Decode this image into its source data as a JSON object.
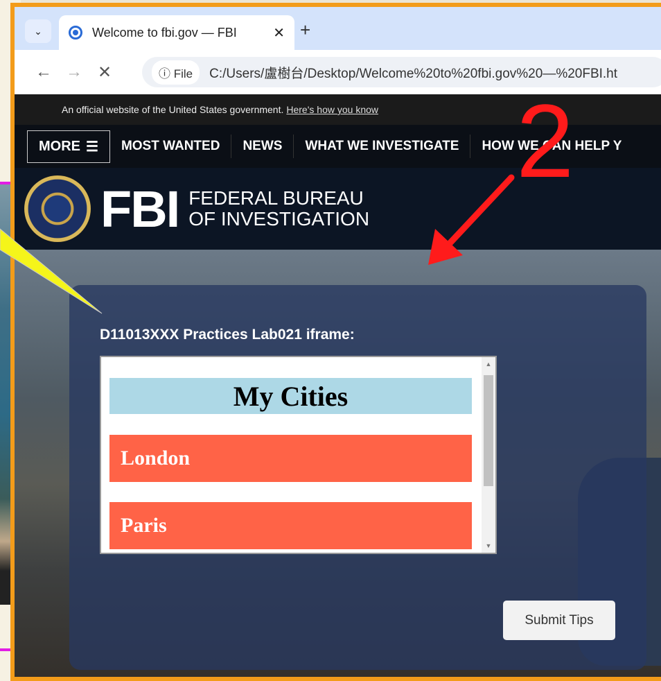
{
  "browser": {
    "tab_title": "Welcome to fbi.gov — FBI",
    "new_tab_symbol": "+",
    "close_symbol": "✕",
    "file_chip": "File",
    "url": "C:/Users/盧樹台/Desktop/Welcome%20to%20fbi.gov%20—%20FBI.ht"
  },
  "banner": {
    "text": "An official website of the United States government.",
    "link": "Here's how you know"
  },
  "nav": {
    "more": "MORE",
    "items": [
      "MOST WANTED",
      "NEWS",
      "WHAT WE INVESTIGATE",
      "HOW WE CAN HELP Y"
    ]
  },
  "brand": {
    "logo_text": "FBI",
    "line1": "FEDERAL BUREAU",
    "line2": "OF INVESTIGATION"
  },
  "main": {
    "iframe_label": "D11013XXX Practices Lab021 iframe:",
    "iframe": {
      "heading": "My Cities",
      "cities": [
        "London",
        "Paris"
      ]
    },
    "submit_button": "Submit Tips"
  },
  "annotations": {
    "number": "2",
    "arrow_color": "#ff1b1b",
    "callout_color": "#f5f51a"
  },
  "colors": {
    "frame_border": "#f39c1a",
    "city_heading_bg": "#add8e6",
    "city_item_bg": "#ff6347"
  }
}
